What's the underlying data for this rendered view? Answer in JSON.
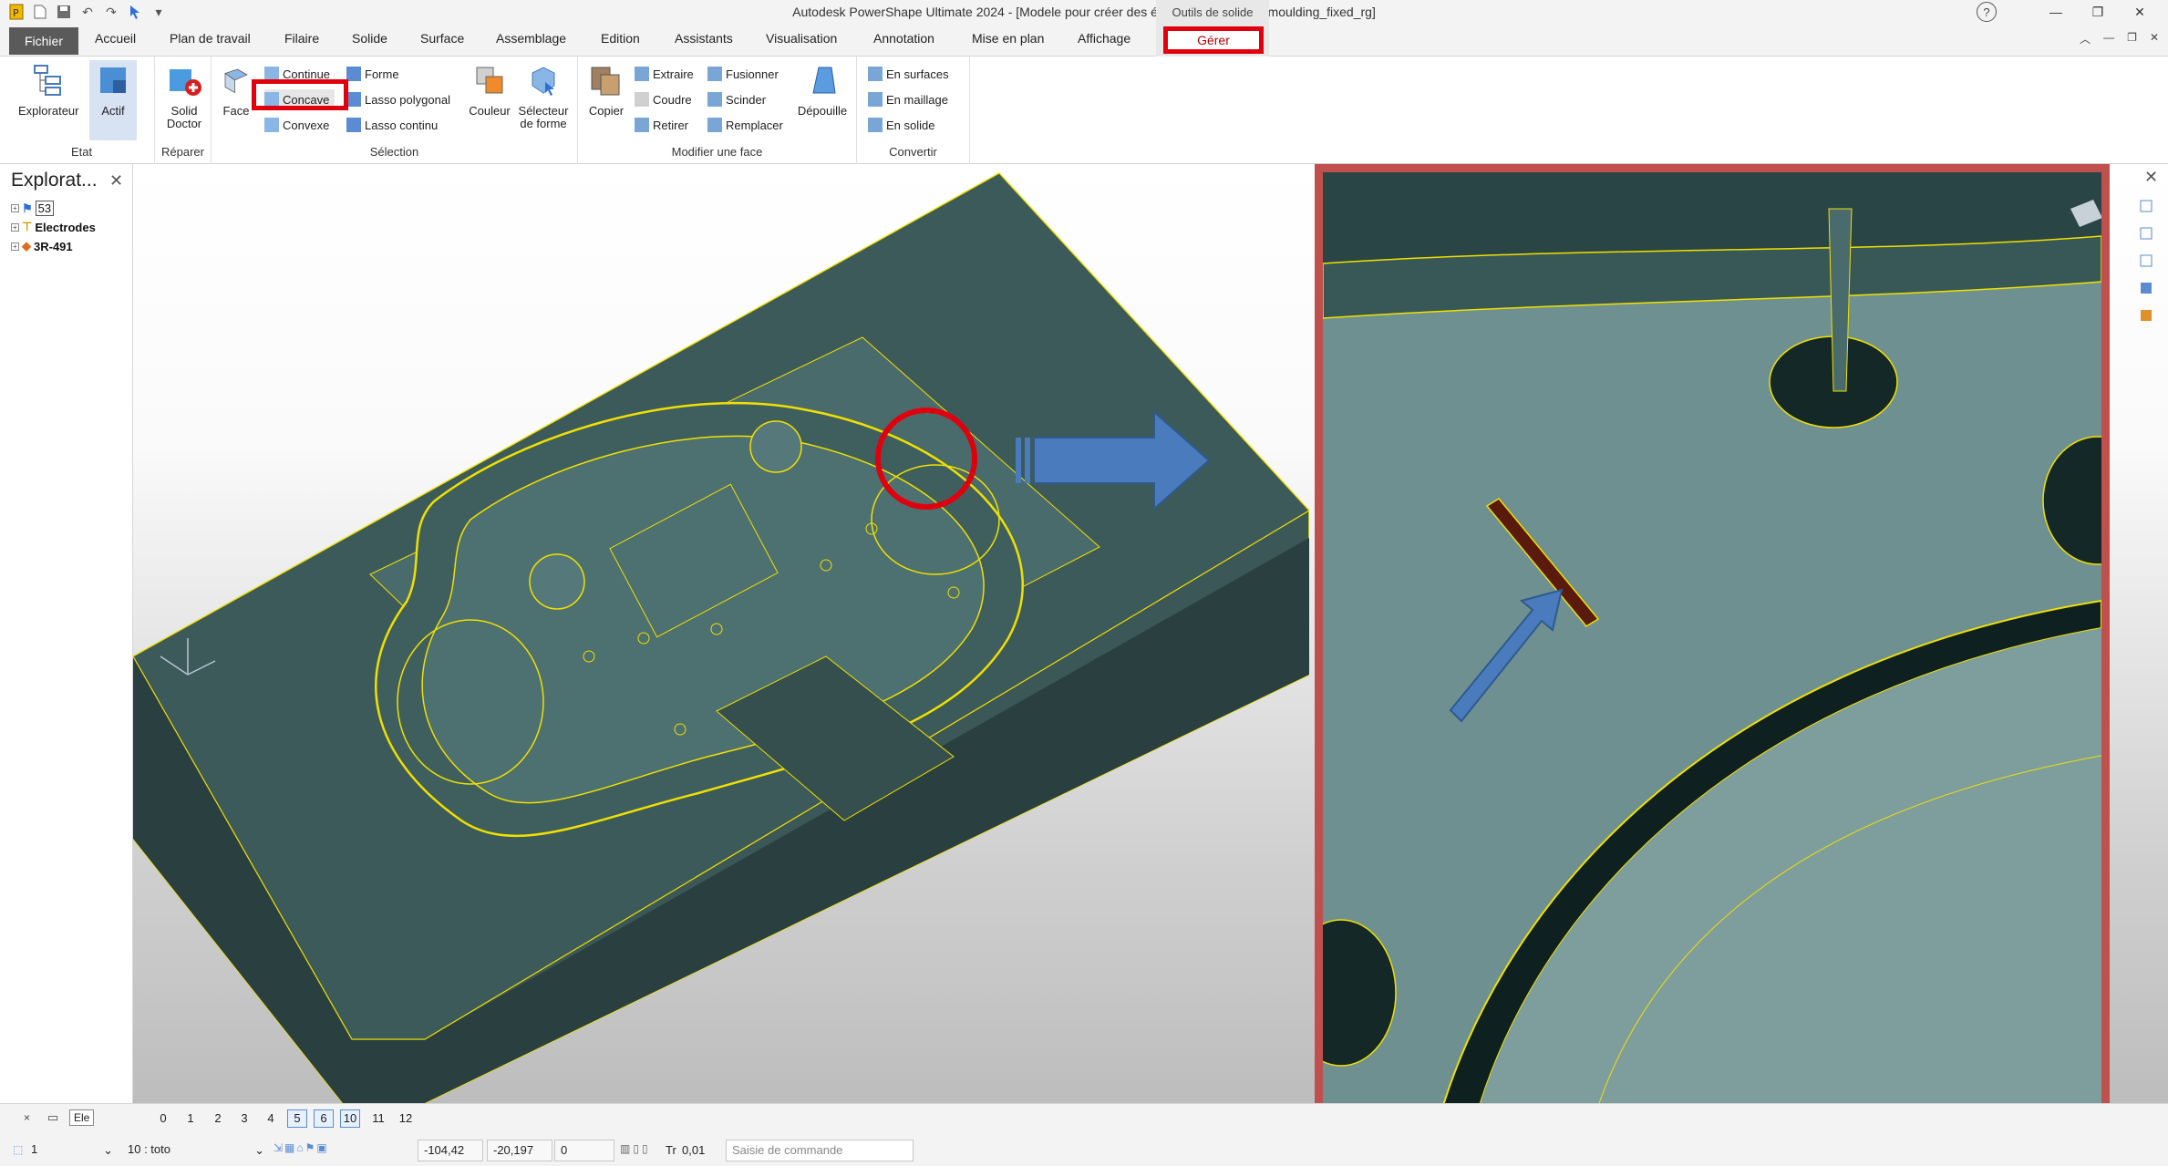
{
  "app_title": "Autodesk PowerShape Ultimate 2024 - [Modele pour créer des électrodes_Speaker moulding_fixed_rg]",
  "context_tab_group": "Outils de solide",
  "tabs": {
    "fichier": "Fichier",
    "items": [
      "Accueil",
      "Plan de travail",
      "Filaire",
      "Solide",
      "Surface",
      "Assemblage",
      "Edition",
      "Assistants",
      "Visualisation",
      "Annotation",
      "Mise en plan",
      "Affichage"
    ],
    "gerer": "Gérer"
  },
  "ribbon": {
    "etat": {
      "title": "Etat",
      "explorateur": "Explorateur",
      "actif": "Actif"
    },
    "reparer": {
      "title": "Réparer",
      "solid_doctor": "Solid Doctor"
    },
    "selection": {
      "title": "Sélection",
      "face": "Face",
      "continue": "Continue",
      "concave": "Concave",
      "convexe": "Convexe",
      "forme": "Forme",
      "lasso_polygonal": "Lasso polygonal",
      "lasso_continu": "Lasso continu",
      "couleur": "Couleur",
      "selecteur_de_forme": "Sélecteur de forme"
    },
    "modifier": {
      "title": "Modifier une face",
      "copier": "Copier",
      "extraire": "Extraire",
      "coudre": "Coudre",
      "retirer": "Retirer",
      "fusionner": "Fusionner",
      "scinder": "Scinder",
      "remplacer": "Remplacer",
      "depouille": "Dépouille"
    },
    "convertir": {
      "title": "Convertir",
      "en_surfaces": "En surfaces",
      "en_maillage": "En maillage",
      "en_solide": "En solide"
    }
  },
  "explorer": {
    "title": "Explorat...",
    "items": [
      "53",
      "Electrodes",
      "3R-491"
    ]
  },
  "levels": {
    "current": "Ele",
    "numbers": [
      "0",
      "1",
      "2",
      "3",
      "4",
      "5",
      "6",
      "10",
      "11",
      "12"
    ],
    "highlighted": [
      "5",
      "6",
      "10"
    ]
  },
  "status": {
    "selector1": "1",
    "selector2": "10 : toto",
    "x": "-104,42",
    "y": "-20,197",
    "z": "0",
    "tr_label": "Tr",
    "tolerance": "0,01",
    "command_placeholder": "Saisie de commande"
  },
  "colors": {
    "model_surface": "#3d5a5a",
    "edge_lines": "#f0e000",
    "highlight_red": "#e0000d",
    "zoom_border": "#c0504d",
    "arrow_blue": "#4a7bbd",
    "selected_face": "#5a1a0c"
  }
}
